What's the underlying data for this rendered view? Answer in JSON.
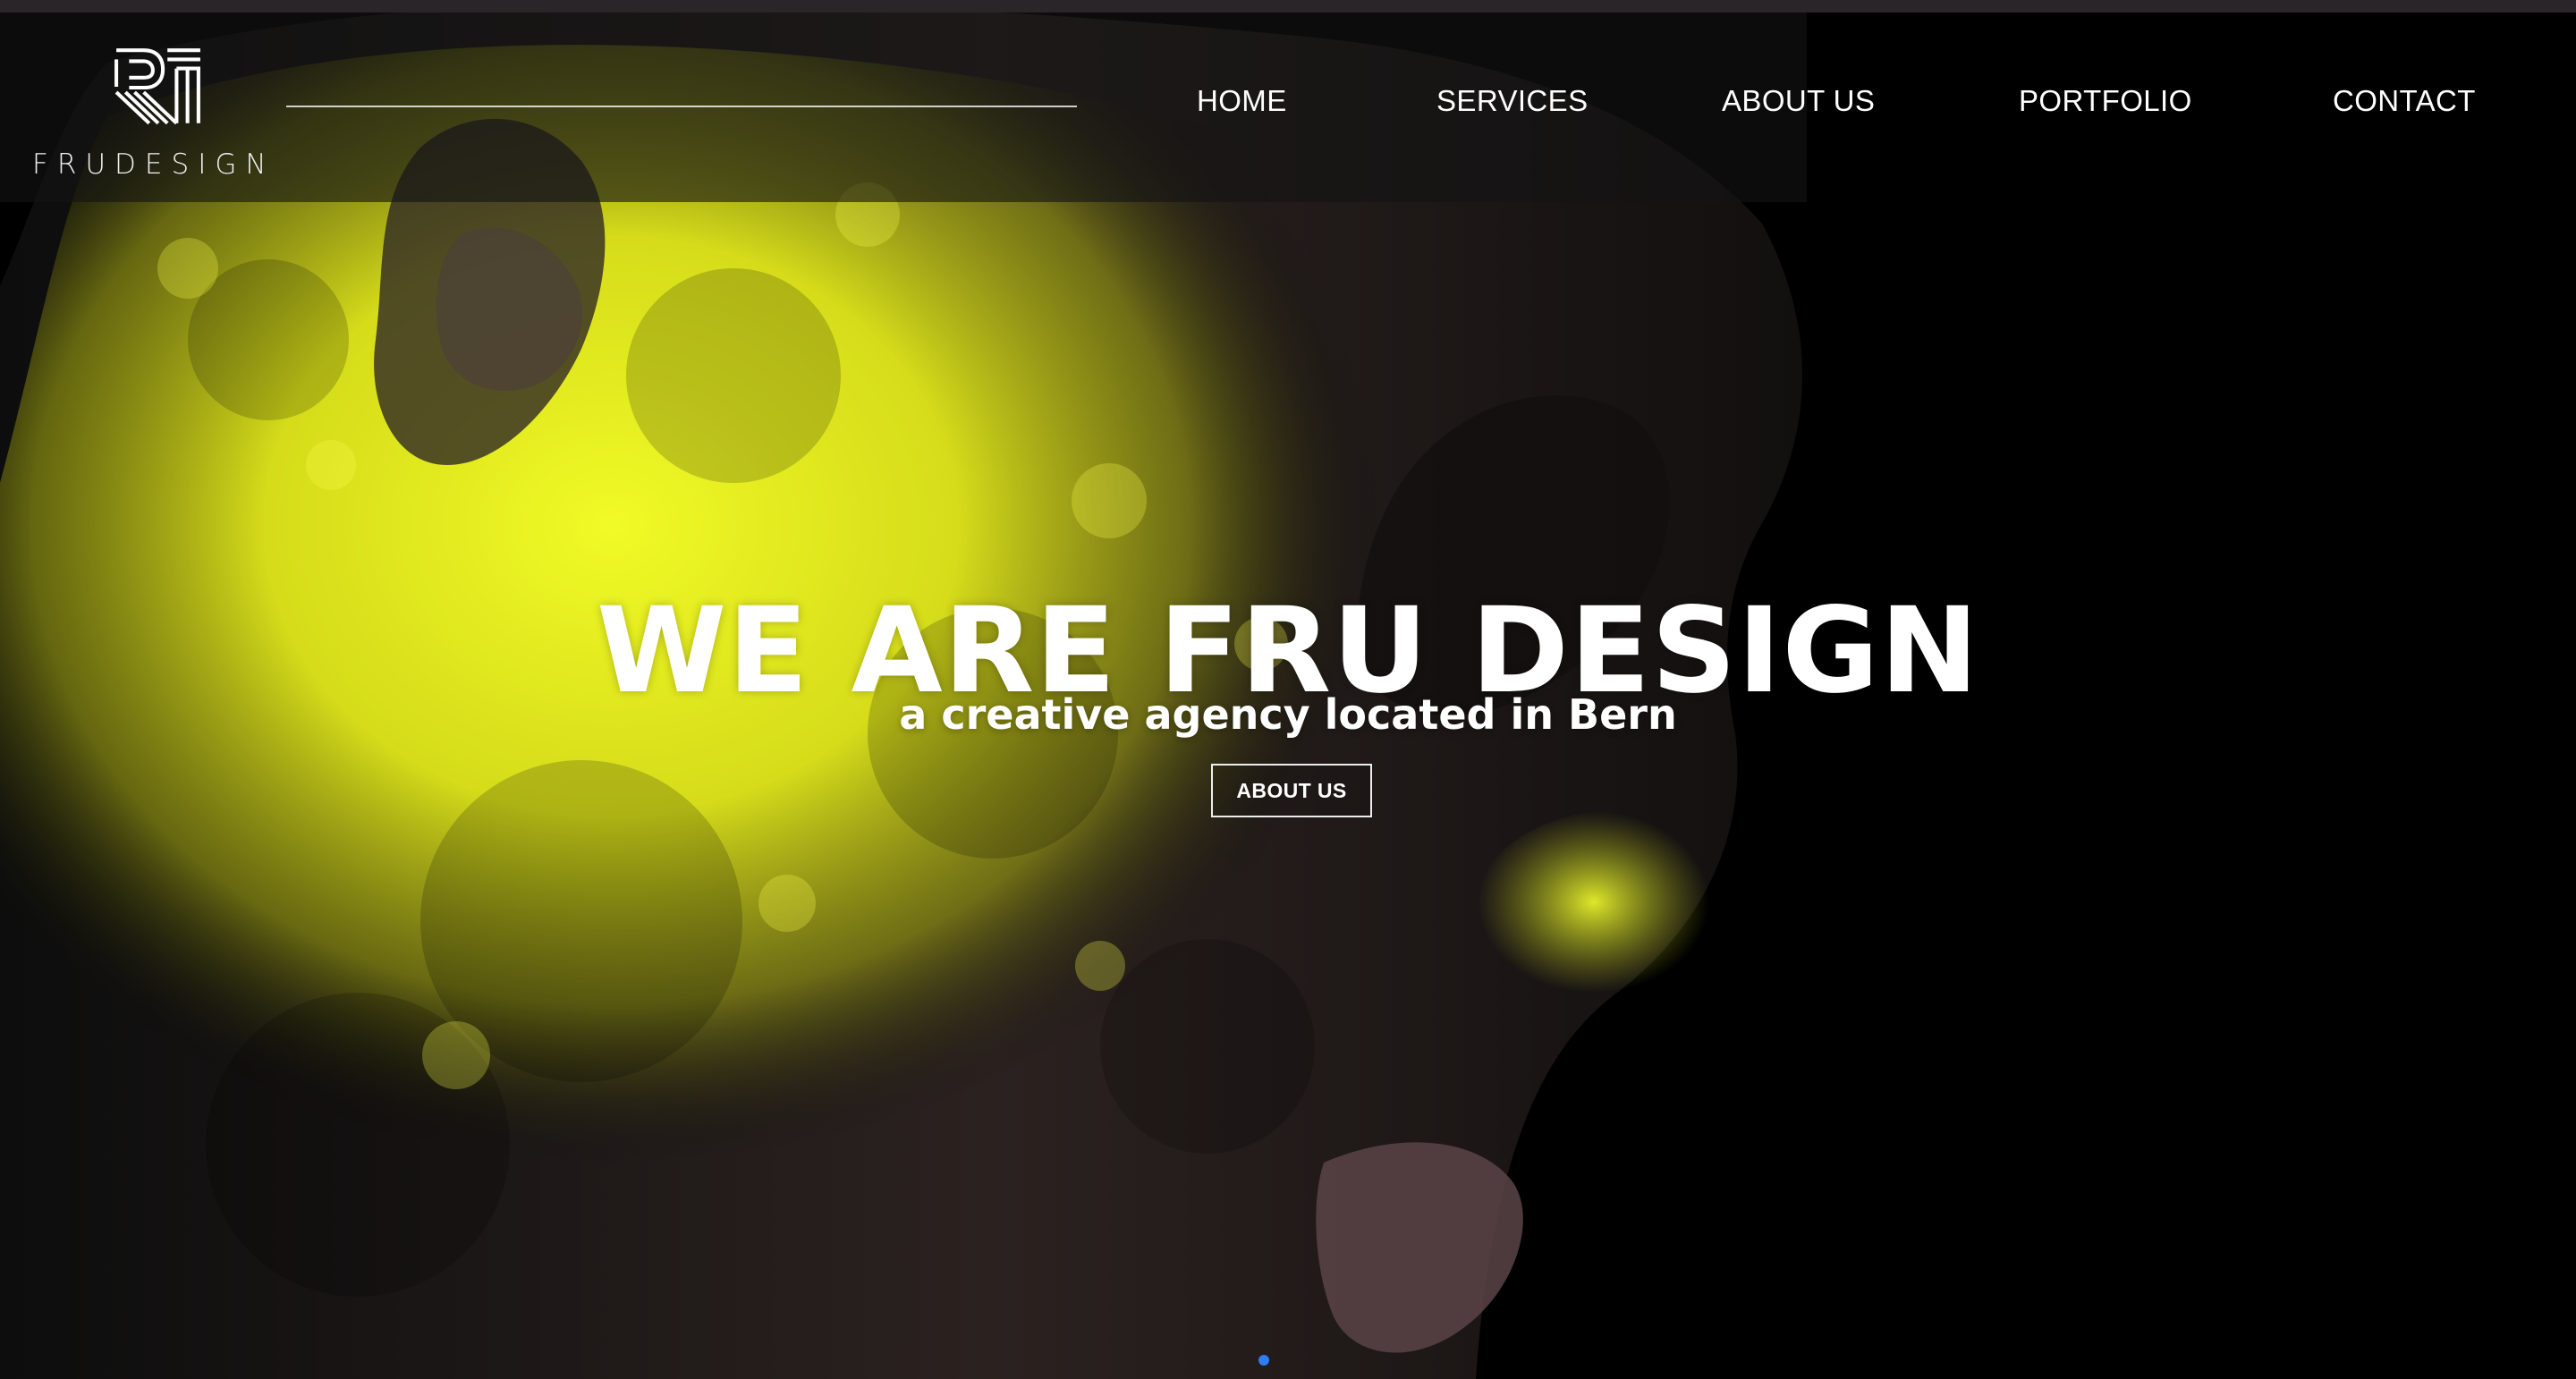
{
  "brand": {
    "logo_text": "FRUDESIGN",
    "logo_icon": "fru-design-logo-mark"
  },
  "nav": {
    "items": [
      {
        "label": "HOME"
      },
      {
        "label": "SERVICES"
      },
      {
        "label": "ABOUT US"
      },
      {
        "label": "PORTFOLIO"
      },
      {
        "label": "CONTACT"
      }
    ]
  },
  "hero": {
    "title": "WE ARE FRU DESIGN",
    "subtitle": "a creative agency located in Bern",
    "button_label": "ABOUT US",
    "accent_color": "#e7f01b",
    "slide_dot_color": "#2e7df6"
  }
}
